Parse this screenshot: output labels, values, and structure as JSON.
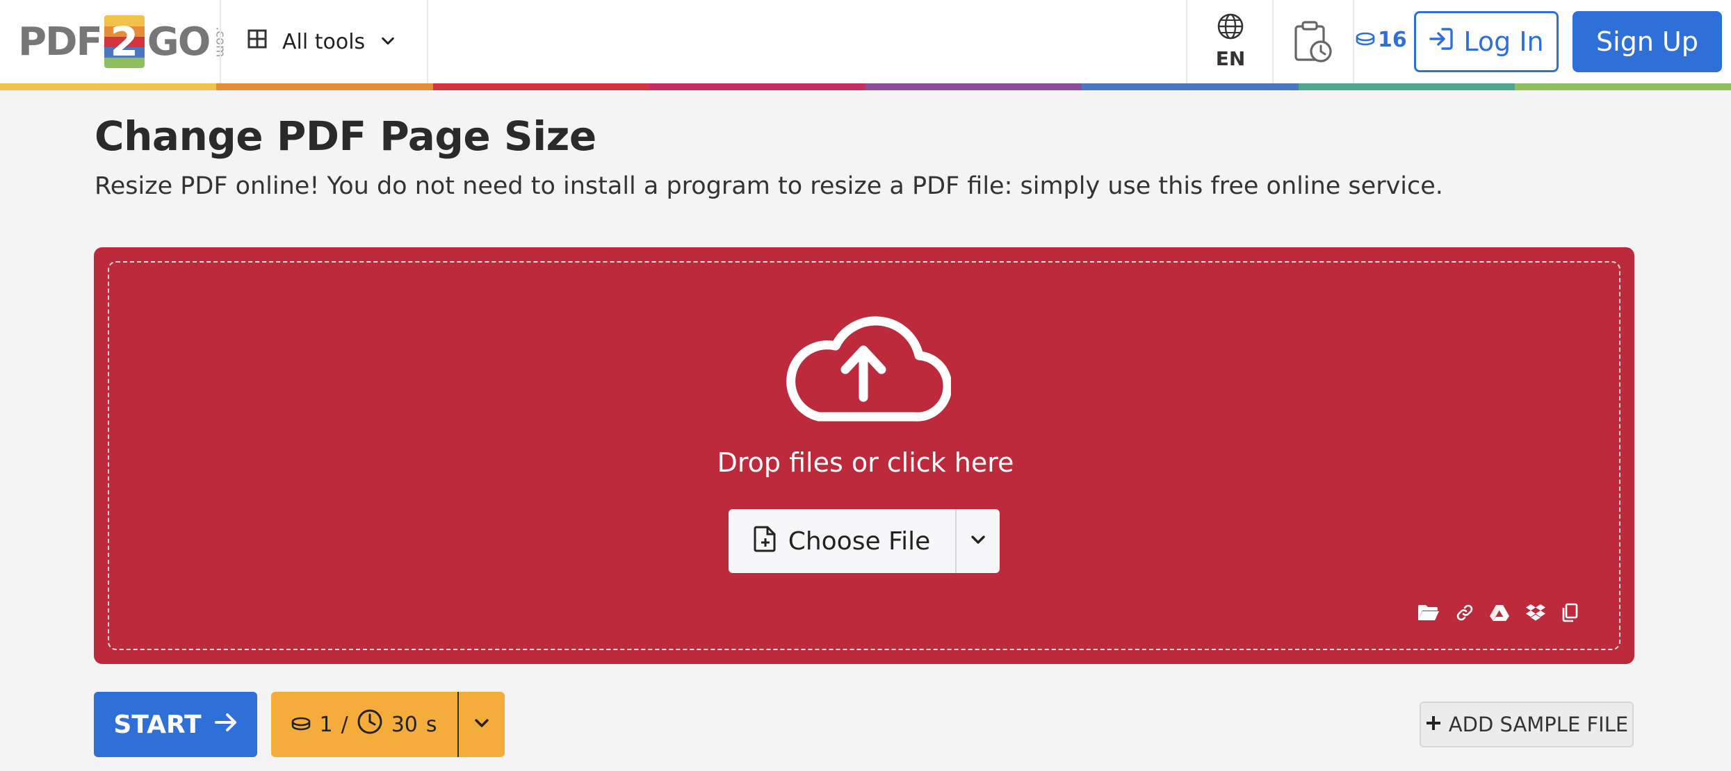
{
  "header": {
    "logo": {
      "left": "PDF",
      "middle": "2",
      "right": "GO",
      "suffix": ".com"
    },
    "all_tools_label": "All tools",
    "language": "EN",
    "credits": "16",
    "login_label": "Log In",
    "signup_label": "Sign Up"
  },
  "main": {
    "title": "Change PDF Page Size",
    "subtitle": "Resize PDF online! You do not need to install a program to resize a PDF file: simply use this free online service.",
    "dropzone": {
      "prompt": "Drop files or click here",
      "choose_file_label": "Choose File",
      "sources": [
        "folder-icon",
        "link-icon",
        "google-drive-icon",
        "dropbox-icon",
        "clipboard-icon"
      ]
    }
  },
  "actions": {
    "start_label": "START",
    "cost_credits": "1",
    "cost_separator": "/",
    "cost_time": "30",
    "cost_time_unit": "s",
    "add_sample_label": "ADD SAMPLE FILE"
  },
  "colors": {
    "brand_blue": "#2f6fd8",
    "dropzone_red": "#bd2a3c",
    "cost_orange": "#f4ad3b",
    "rainbow": [
      "#f0c24a",
      "#e58d3a",
      "#d33442",
      "#c42f62",
      "#8a4f98",
      "#4a76c2",
      "#4fa68e",
      "#8fbf5f"
    ]
  }
}
